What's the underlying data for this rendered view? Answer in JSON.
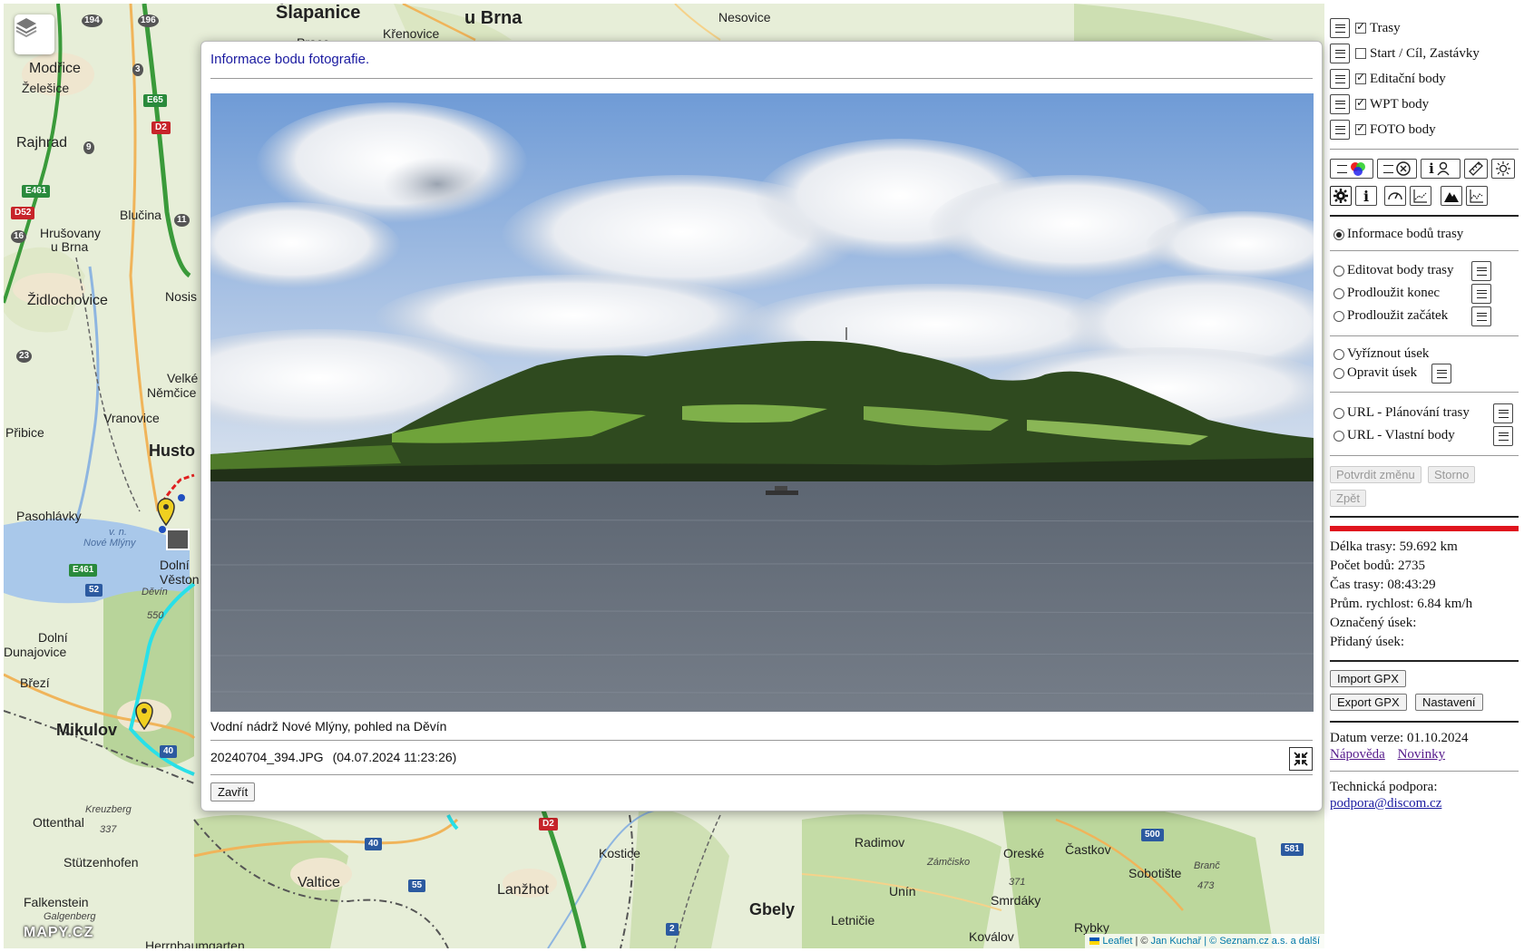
{
  "map": {
    "labels": {
      "slapanice": "Šlapanice",
      "u_brna": "u Brna",
      "nesovice": "Nesovice",
      "krenovice": "Křenovice",
      "prace": "Prace",
      "modrice": "Modřice",
      "zelesice": "Želešice",
      "rajhrad": "Rajhrad",
      "blucina": "Blučina",
      "hrusovany": "Hrušovany",
      "hrusovany_2": "u Brna",
      "zidlochovice": "Židlochovice",
      "nosis": "Nosis",
      "velke": "Velké",
      "nemcice": "Němčice",
      "vranovice": "Vranovice",
      "pribice": "Přibice",
      "husto": "Husto",
      "pasohlavky": "Pasohlávky",
      "vn": "v. n.",
      "nove_mlyny": "Nové Mlýny",
      "dolni": "Dolní",
      "vestonice": "Věston",
      "devin": "Děvín",
      "devin_alt": "550",
      "dolni_dunajovice": "Dolní",
      "dunajovice": "Dunajovice",
      "breze": "Březí",
      "mikulov": "Mikulov",
      "kreuzberg": "Kreuzberg",
      "kreuzberg_alt": "337",
      "ottenthal": "Ottenthal",
      "stutzenhofen": "Stützenhofen",
      "falkenstein": "Falkenstein",
      "galgenberg": "Galgenberg",
      "herrnbaumgarten": "Herrnbaumgarten",
      "valtice": "Valtice",
      "lanzhot": "Lanžhot",
      "kostice": "Kostice",
      "gbely": "Gbely",
      "radimov": "Radimov",
      "zamcisko": "Zámčisko",
      "unin": "Unín",
      "oreske": "Oreské",
      "castkov": "Častkov",
      "smrdaky": "Smrdáky",
      "sobotiste": "Sobotište",
      "branc": "Branč",
      "branc_alt": "473",
      "letnicie": "Letničie",
      "kovalov": "Koválov",
      "rybky": "Rybky",
      "alt_371": "371"
    },
    "roads": {
      "r194": "194",
      "r196": "196",
      "r3": "3",
      "e65": "E65",
      "d2": "D2",
      "r9": "9",
      "e461": "E461",
      "d52": "D52",
      "r16": "16",
      "r11": "11",
      "r23": "23",
      "e461b": "E461",
      "r52": "52",
      "r40": "40",
      "r40b": "40",
      "r55": "55",
      "d2b": "D2",
      "r2": "2",
      "r500": "500",
      "r581": "581"
    },
    "logo": "MAPY.CZ",
    "attribution": {
      "leaflet": "Leaflet",
      "sep": " | © ",
      "author": "Jan Kuchař",
      "seznam": " | © Seznam.cz a.s. a další"
    }
  },
  "modal": {
    "title": "Informace bodu fotografie.",
    "caption": "Vodní nádrž Nové Mlýny, pohled na Děvín",
    "filename": "20240704_394.JPG",
    "datetime": "(04.07.2024 11:23:26)",
    "close_label": "Zavřít"
  },
  "sidebar": {
    "layers": [
      {
        "label": "Trasy",
        "checked": true
      },
      {
        "label": "Start / Cíl, Zastávky",
        "checked": false
      },
      {
        "label": "Editační body",
        "checked": true
      },
      {
        "label": "WPT body",
        "checked": true
      },
      {
        "label": "FOTO body",
        "checked": true
      }
    ],
    "modes": {
      "info": "Informace bodů trasy",
      "edit": "Editovat body trasy",
      "extend_end": "Prodloužit konec",
      "extend_start": "Prodloužit začátek",
      "cut": "Vyříznout úsek",
      "fix": "Opravit úsek",
      "url_plan": "URL - Plánování trasy",
      "url_own": "URL - Vlastní body"
    },
    "buttons": {
      "confirm": "Potvrdit změnu",
      "cancel": "Storno",
      "back": "Zpět",
      "import": "Import GPX",
      "export": "Export GPX",
      "settings": "Nastavení"
    },
    "stats": {
      "length": "Délka trasy: 59.692 km",
      "points": "Počet bodů: 2735",
      "time": "Čas trasy: 08:43:29",
      "speed": "Prům. rychlost: 6.84 km/h",
      "marked": "Označený úsek:",
      "added": "Přidaný úsek:"
    },
    "version": "Datum verze: 01.10.2024",
    "help": "Nápověda",
    "news": "Novinky",
    "support_label": "Technická podpora:",
    "support_email": "podpora@discom.cz",
    "accent_color": "#e0141e"
  }
}
